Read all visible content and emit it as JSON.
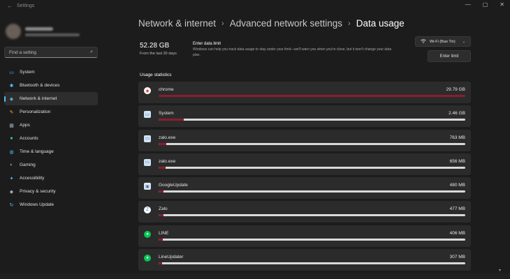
{
  "titlebar": {
    "app_title": "Settings",
    "back_glyph": "←",
    "minimize": "—",
    "maximize": "▢",
    "close": "✕"
  },
  "sidebar": {
    "search_placeholder": "Find a setting",
    "items": [
      {
        "label": "System",
        "icon": "system-icon",
        "glyph": "▭",
        "color": "#4cc2ff"
      },
      {
        "label": "Bluetooth & devices",
        "icon": "bluetooth-icon",
        "glyph": "✱",
        "color": "#4cc2ff"
      },
      {
        "label": "Network & internet",
        "icon": "network-icon",
        "glyph": "◈",
        "color": "#7ad1ff",
        "active": true
      },
      {
        "label": "Personalization",
        "icon": "brush-icon",
        "glyph": "✎",
        "color": "#f4a261"
      },
      {
        "label": "Apps",
        "icon": "apps-icon",
        "glyph": "▦",
        "color": "#9aa8b8"
      },
      {
        "label": "Accounts",
        "icon": "accounts-icon",
        "glyph": "●",
        "color": "#3ddc97"
      },
      {
        "label": "Time & language",
        "icon": "globe-icon",
        "glyph": "◍",
        "color": "#4cc2ff"
      },
      {
        "label": "Gaming",
        "icon": "gaming-icon",
        "glyph": "◐",
        "color": "#b0b0b0"
      },
      {
        "label": "Accessibility",
        "icon": "accessibility-icon",
        "glyph": "✦",
        "color": "#4cc2ff"
      },
      {
        "label": "Privacy & security",
        "icon": "shield-icon",
        "glyph": "◆",
        "color": "#9aa8b8"
      },
      {
        "label": "Windows Update",
        "icon": "update-icon",
        "glyph": "↻",
        "color": "#4cc2ff"
      }
    ]
  },
  "breadcrumb": {
    "part1": "Network & internet",
    "part2": "Advanced network settings",
    "current": "Data usage",
    "sep": "›"
  },
  "summary": {
    "total": "52.28 GB",
    "period": "From the last 30 days"
  },
  "limit": {
    "title": "Enter data limit",
    "desc": "Windows can help you track data usage to stay under your limit—we'll warn you when you're close, but it won't change your data plan.",
    "button": "Enter limit"
  },
  "network_select": {
    "value": "Wi-Fi (Bao Tin)"
  },
  "usage": {
    "title": "Usage statistics",
    "apps": [
      {
        "name": "chrome",
        "size": "29.79 GB",
        "fraction": 1.0,
        "icon": "chrome-icon",
        "glyph": "◉",
        "bg": "#ffffff",
        "fg": "#d93025"
      },
      {
        "name": "System",
        "size": "2.46 GB",
        "fraction": 0.083,
        "icon": "system-app-icon",
        "glyph": "▭",
        "bg": "#cfe2f3",
        "fg": "#1f5fa8"
      },
      {
        "name": "zalo.exe",
        "size": "763 MB",
        "fraction": 0.026,
        "icon": "zalo-exe-icon",
        "glyph": "▭",
        "bg": "#cfe2f3",
        "fg": "#1f5fa8"
      },
      {
        "name": "zalo.exe",
        "size": "656 MB",
        "fraction": 0.022,
        "icon": "zalo-exe-icon",
        "glyph": "▭",
        "bg": "#cfe2f3",
        "fg": "#1f5fa8"
      },
      {
        "name": "GoogleUpdate",
        "size": "480 MB",
        "fraction": 0.016,
        "icon": "google-update-icon",
        "glyph": "▣",
        "bg": "#dfe6ee",
        "fg": "#3c6fb5"
      },
      {
        "name": "Zalo",
        "size": "477 MB",
        "fraction": 0.016,
        "icon": "zalo-icon",
        "glyph": "Z",
        "bg": "#ffffff",
        "fg": "#0068ff"
      },
      {
        "name": "LINE",
        "size": "406 MB",
        "fraction": 0.014,
        "icon": "line-icon",
        "glyph": "●",
        "bg": "#06c755",
        "fg": "#ffffff"
      },
      {
        "name": "LineUpdater",
        "size": "307 MB",
        "fraction": 0.01,
        "icon": "line-updater-icon",
        "glyph": "●",
        "bg": "#06c755",
        "fg": "#ffffff"
      }
    ]
  }
}
